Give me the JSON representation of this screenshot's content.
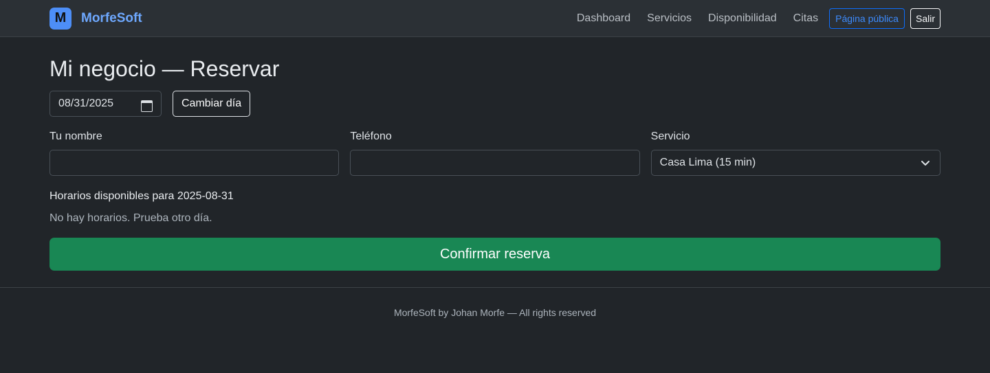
{
  "nav": {
    "logo_letter": "M",
    "brand": "MorfeSoft",
    "links": [
      "Dashboard",
      "Servicios",
      "Disponibilidad",
      "Citas"
    ],
    "public_page": "Página pública",
    "logout": "Salir"
  },
  "main": {
    "title": "Mi negocio — Reservar",
    "date_value": "08/31/2025",
    "change_day": "Cambiar día",
    "name_label": "Tu nombre",
    "name_value": "",
    "phone_label": "Teléfono",
    "phone_value": "",
    "service_label": "Servicio",
    "service_selected": "Casa Lima (15 min)",
    "slots_label": "Horarios disponibles para 2025-08-31",
    "slots_empty": "No hay horarios. Prueba otro día.",
    "confirm": "Confirmar reserva"
  },
  "footer": {
    "text": "MorfeSoft by Johan Morfe — All rights reserved"
  },
  "colors": {
    "background": "#212529",
    "navbar": "#2b3035",
    "brand": "#6ea8fe",
    "primary": "#0d6efd",
    "success": "#198754"
  },
  "icons": [
    "calendar-icon",
    "chevron-down-icon"
  ]
}
